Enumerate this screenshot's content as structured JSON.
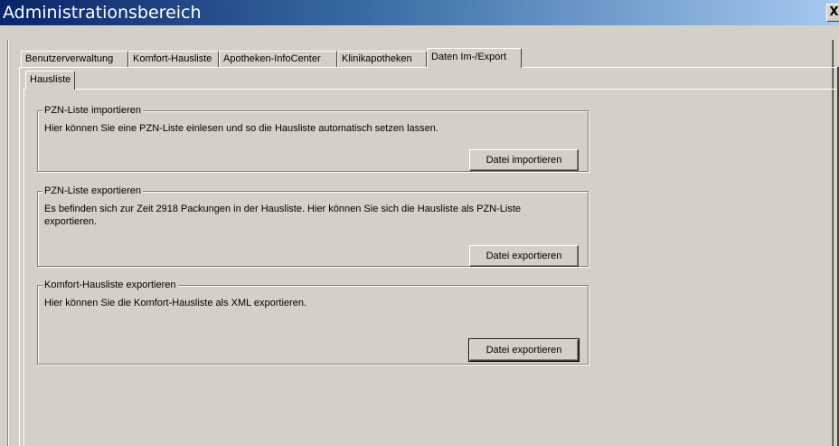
{
  "window": {
    "title": "Administrationsbereich",
    "close_glyph": "X"
  },
  "tabs": [
    {
      "label": "Benutzerverwaltung",
      "active": false
    },
    {
      "label": "Komfort-Hausliste",
      "active": false
    },
    {
      "label": "Apotheken-InfoCenter",
      "active": false
    },
    {
      "label": "Klinikapotheken",
      "active": false
    },
    {
      "label": "Daten Im-/Export",
      "active": true
    }
  ],
  "subtabs": [
    {
      "label": "Hausliste",
      "active": true
    }
  ],
  "groups": {
    "import": {
      "title": "PZN-Liste importieren",
      "text": "Hier können Sie eine PZN-Liste einlesen und so die Hausliste automatisch setzen lassen.",
      "button": "Datei importieren"
    },
    "export": {
      "title": "PZN-Liste exportieren",
      "text": "Es befinden sich zur Zeit 2918 Packungen in der Hausliste. Hier können Sie sich die Hausliste als PZN-Liste exportieren.",
      "button": "Datei exportieren"
    },
    "komfort_export": {
      "title": "Komfort-Hausliste exportieren",
      "text": "Hier können Sie die Komfort-Hausliste als XML exportieren.",
      "button": "Datei exportieren"
    }
  }
}
